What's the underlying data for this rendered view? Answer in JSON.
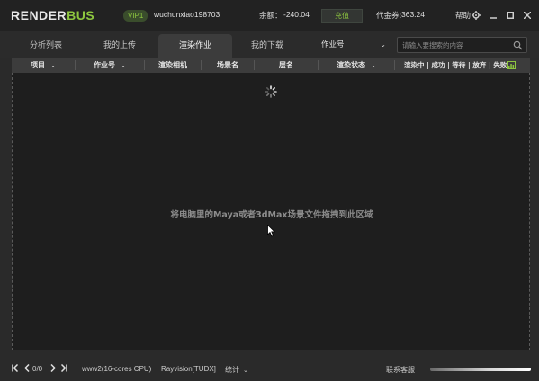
{
  "app": {
    "logo_part1": "RENDER",
    "logo_part2": "BUS",
    "vip": "VIP1",
    "username": "wuchunxiao198703",
    "balance_label": "余额：",
    "balance_value": "-240.04",
    "recharge_label": "充值",
    "coupon_label": "代金券:",
    "coupon_value": "363.24",
    "help_label": "帮助",
    "window_controls": [
      "gear-icon",
      "minimize-icon",
      "maximize-icon",
      "close-icon"
    ]
  },
  "tabs": [
    {
      "label": "分析列表",
      "active": false
    },
    {
      "label": "我的上传",
      "active": false
    },
    {
      "label": "渲染作业",
      "active": true
    },
    {
      "label": "我的下载",
      "active": false
    }
  ],
  "search": {
    "type_selected": "作业号",
    "placeholder": "请输入要搜索的内容"
  },
  "columns": {
    "project": "项目",
    "job_id": "作业号",
    "render_camera": "渲染相机",
    "scene_name": "场景名",
    "layer_name": "层名",
    "render_status": "渲染状态",
    "status_counts": "渲染中 | 成功 | 等待 | 放弃 | 失败"
  },
  "main": {
    "drop_hint": "将电脑里的Maya或者3dMax场景文件拖拽到此区域"
  },
  "footer": {
    "page": "0/0",
    "platform": "www2(16-cores CPU)",
    "vendor": "Rayvision[TUDX]",
    "stats_label": "统计",
    "contact_label": "联系客服"
  },
  "colors": {
    "accent_green": "#8dc63f",
    "background": "#1e1e1e",
    "header": "#3c3c3c"
  }
}
